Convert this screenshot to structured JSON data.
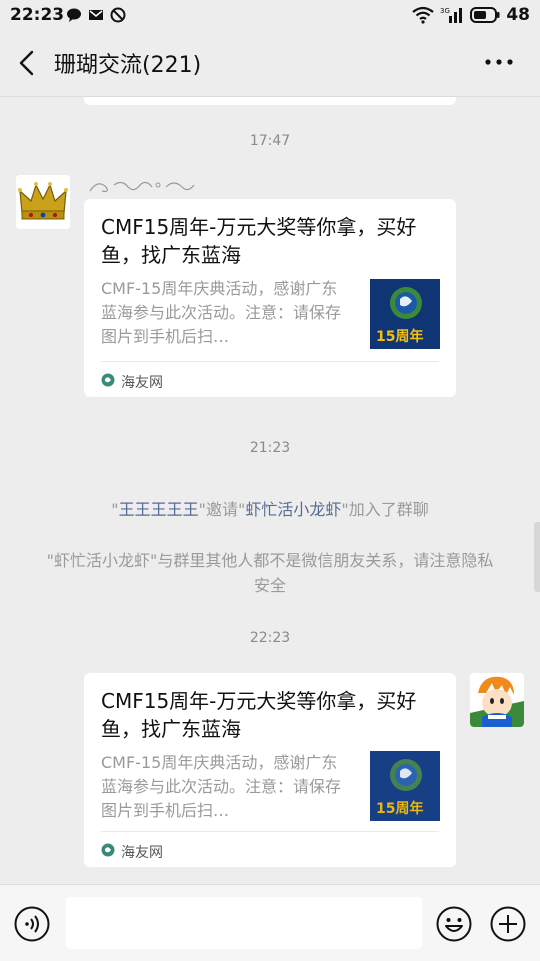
{
  "status_bar": {
    "time": "22:23",
    "battery": "48",
    "network": "3G",
    "icons_left": [
      "chat-bubble-icon",
      "mail-icon",
      "block-icon"
    ],
    "icons_right": [
      "wifi-icon",
      "signal-icon",
      "battery-icon"
    ]
  },
  "header": {
    "title": "珊瑚交流(221)",
    "back_icon": "chevron-left-icon",
    "more_icon": "more-icon"
  },
  "chat": {
    "timestamps": [
      "17:47",
      "21:23",
      "22:23"
    ],
    "messages": [
      {
        "title": "CMF15周年-万元大奖等你拿，买好鱼，找广东蓝海",
        "desc": "CMF-15周年庆典活动，感谢广东蓝海参与此次活动。注意：请保存图片到手机后扫…",
        "source": "海友网",
        "thumb_text": "15周年"
      },
      {
        "title": "CMF15周年-万元大奖等你拿，买好鱼，找广东蓝海",
        "desc": "CMF-15周年庆典活动，感谢广东蓝海参与此次活动。注意：请保存图片到手机后扫…",
        "source": "海友网",
        "thumb_text": "15周年"
      }
    ],
    "system_invite": {
      "q1": "\"",
      "inviter": "王王王王王",
      "mid": "\"邀请\"",
      "invitee": "虾忙活小龙虾",
      "tail": "\"加入了群聊"
    },
    "system_privacy": "\"虾忙活小龙虾\"与群里其他人都不是微信朋友关系，请注意隐私安全"
  },
  "input_bar": {
    "voice_icon": "voice-icon",
    "emoji_icon": "emoji-icon",
    "plus_icon": "plus-icon"
  },
  "colors": {
    "background": "#ededed",
    "link": "#576b95",
    "system_text": "#9a9a9a"
  }
}
